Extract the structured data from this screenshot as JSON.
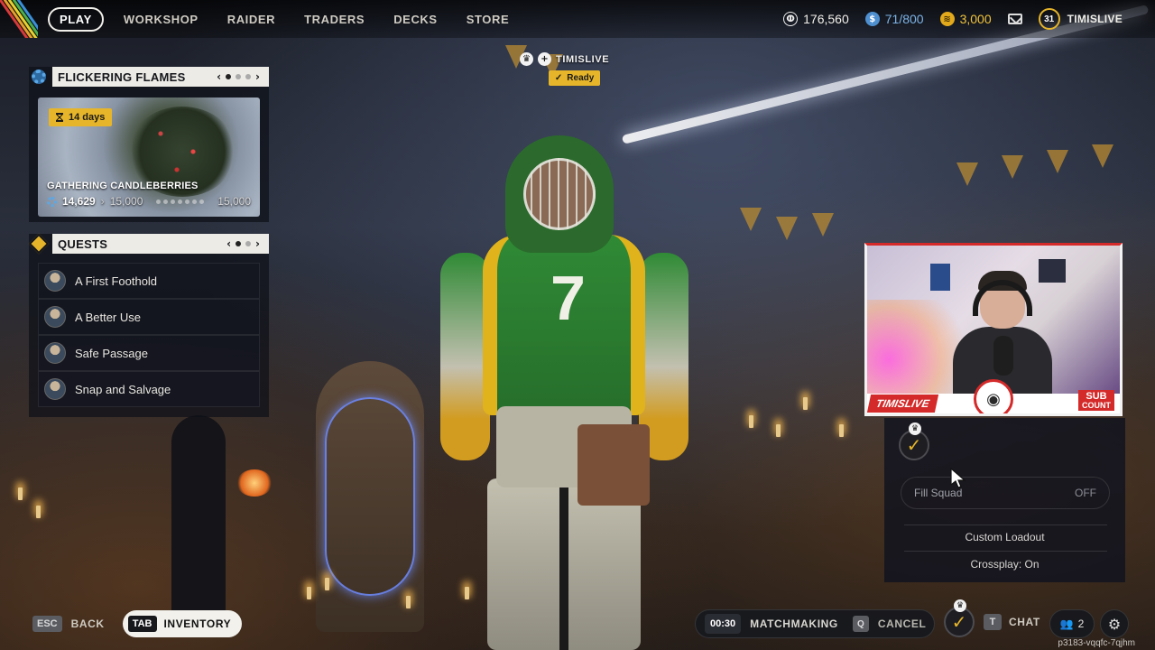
{
  "nav": {
    "items": [
      "PLAY",
      "WORKSHOP",
      "RAIDER",
      "TRADERS",
      "DECKS",
      "STORE"
    ],
    "active_index": 0
  },
  "currency": {
    "credits": "176,560",
    "raider_tokens": "71/800",
    "coins": "3,000"
  },
  "player": {
    "level": "31",
    "username": "TIMISLIVE"
  },
  "event": {
    "title": "FLICKERING FLAMES",
    "timer": "14  days",
    "name": "GATHERING CANDLEBERRIES",
    "progress_current": "14,629",
    "progress_target": "15,000",
    "progress_end": "15,000"
  },
  "quests": {
    "title": "QUESTS",
    "items": [
      "A First Foothold",
      "A Better Use",
      "Safe Passage",
      "Snap and Salvage"
    ]
  },
  "squad": {
    "member_name": "TIMISLIVE",
    "status": "Ready",
    "fill_squad_label": "Fill Squad",
    "fill_squad_value": "OFF",
    "custom_loadout": "Custom Loadout",
    "crossplay": "Crossplay: On"
  },
  "stream_overlay": {
    "name": "TIMISLIVE",
    "sub_line1": "SUB",
    "sub_line2": "COUNT"
  },
  "bottom": {
    "back_key": "ESC",
    "back_label": "BACK",
    "inventory_key": "TAB",
    "inventory_label": "INVENTORY",
    "mm_time": "00:30",
    "mm_label": "MATCHMAKING",
    "cancel_key": "Q",
    "cancel_label": "CANCEL",
    "chat_key": "T",
    "chat_label": "CHAT",
    "friends_count": "2",
    "build_id": "p3183-vqqfc-7qjhm"
  },
  "colors": {
    "accent_gold": "#e6b52a",
    "overlay_red": "#d42a2a",
    "panel_header": "#ecebe6"
  }
}
